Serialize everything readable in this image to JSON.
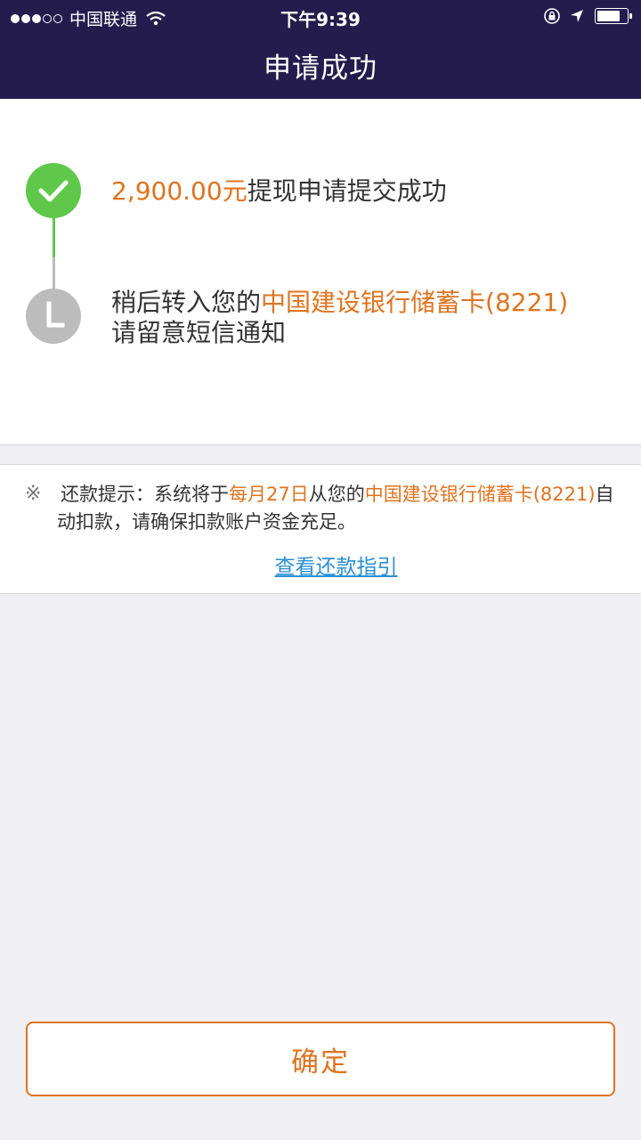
{
  "status_bar": {
    "carrier": "中国联通",
    "time": "下午9:39",
    "signal_filled": 3,
    "signal_total": 5
  },
  "nav": {
    "title": "申请成功"
  },
  "steps": {
    "step1": {
      "amount": "2,900.00元",
      "text": "提现申请提交成功",
      "status": "completed"
    },
    "step2": {
      "prefix": "稍后转入您的",
      "bank": "中国建设银行储蓄卡(8221)",
      "line2": "请留意短信通知",
      "status": "pending"
    }
  },
  "notice": {
    "mark": "※",
    "label": "还款提示：系统将于",
    "date": "每月27日",
    "mid": "从您的",
    "bank": "中国建设银行储蓄卡(8221)",
    "tail": "自动扣款，请确保扣款账户资金充足。",
    "link": "查看还款指引"
  },
  "confirm_button": "确定",
  "colors": {
    "nav_bg": "#241c4d",
    "accent": "#e0731f",
    "success": "#5fc84a",
    "pending": "#bcbcbc",
    "link": "#2a8fd4"
  }
}
